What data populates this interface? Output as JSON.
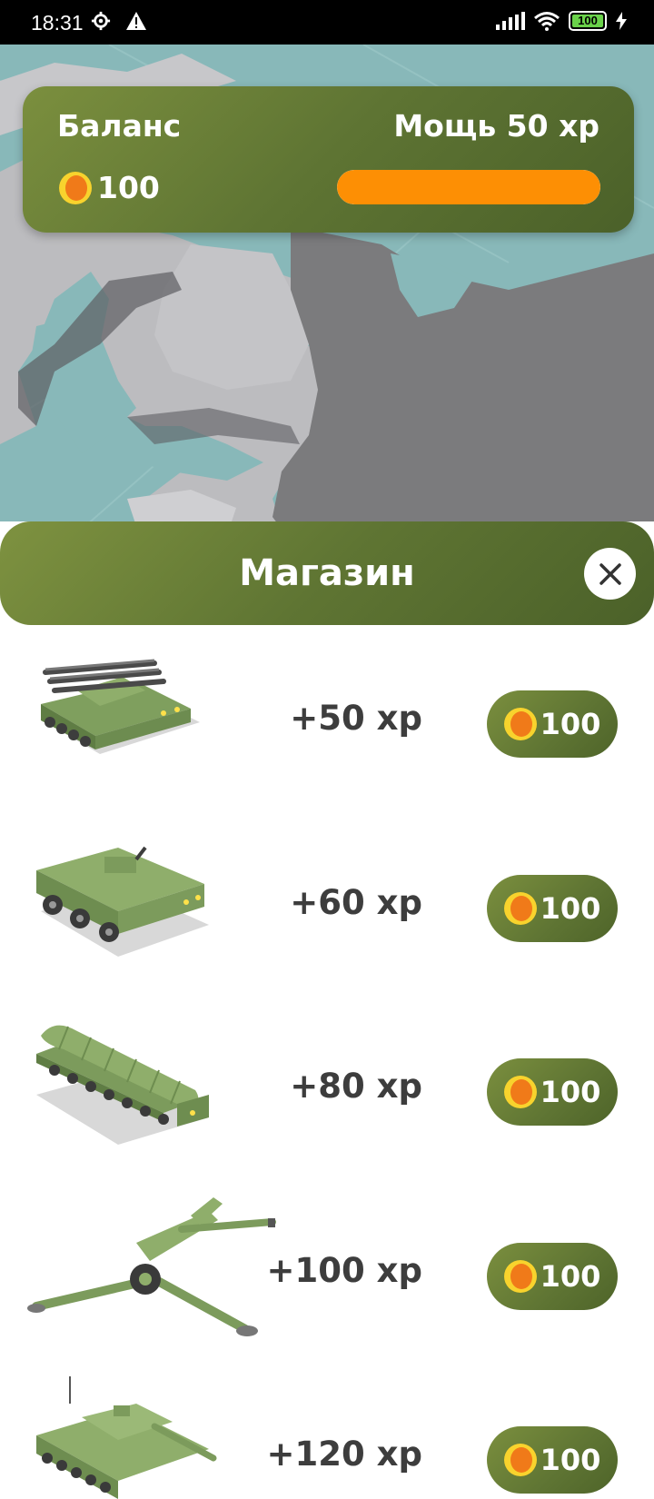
{
  "status_bar": {
    "time": "18:31",
    "battery": "100"
  },
  "balance": {
    "title": "Баланс",
    "coins": "100",
    "power_label": "Мощь 50 xp",
    "power_progress": 1.0
  },
  "shop": {
    "title": "Магазин",
    "items": [
      {
        "power": "+50 xp",
        "price": "100",
        "icon": "missile-launcher-vehicle"
      },
      {
        "power": "+60 xp",
        "price": "100",
        "icon": "armored-personnel-carrier"
      },
      {
        "power": "+80 xp",
        "price": "100",
        "icon": "missile-transporter-truck"
      },
      {
        "power": "+100 xp",
        "price": "100",
        "icon": "howitzer-cannon"
      },
      {
        "power": "+120 xp",
        "price": "100",
        "icon": "tank"
      }
    ]
  },
  "colors": {
    "panel_green": "#5e7433",
    "power_bar": "#fd8f04",
    "coin_outer": "#f8d32d",
    "coin_inner": "#f07a19"
  }
}
